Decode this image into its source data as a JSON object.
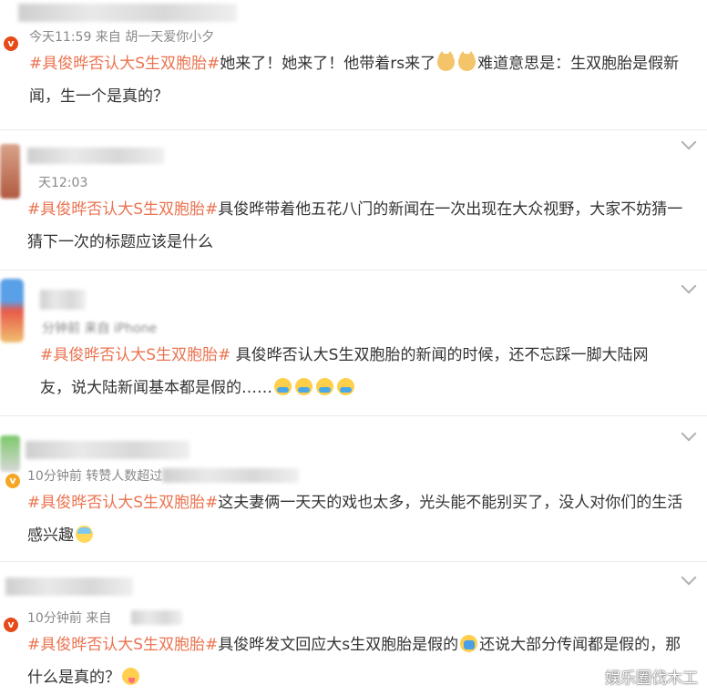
{
  "posts": [
    {
      "meta": "今天11:59  来自 胡一天爱你小夕",
      "tag": "#具俊晔否认大S生双胞胎#",
      "text": "她来了！她来了！他带着rs来了",
      "emojis": [
        "cat-icon",
        "cat-icon"
      ],
      "text2": "难道意思是：生双胞胎是假新闻，生一个是真的？"
    },
    {
      "meta": "天12:03",
      "tag": "#具俊晔否认大S生双胞胎#",
      "text": "具俊晔带着他五花八门的新闻在一次出现在大众视野，大家不妨猜一猜下一次的标题应该是什么",
      "emojis": [],
      "text2": ""
    },
    {
      "meta": "分钟前  来自 iPhone",
      "tag": "#具俊晔否认大S生双胞胎#",
      "text": " 具俊晔否认大S生双胞胎的新闻的时候，还不忘踩一脚大陆网友，说大陆新闻基本都是假的……",
      "emojis": [
        "crying-icon",
        "crying-icon",
        "crying-icon",
        "crying-icon"
      ],
      "text2": ""
    },
    {
      "meta": "10分钟前  转赞人数超过",
      "tag": "#具俊晔否认大S生双胞胎#",
      "text": "这夫妻俩一天天的戏也太多，光头能不能别买了，没人对你们的生活感兴趣",
      "emojis": [
        "fearful-icon"
      ],
      "text2": ""
    },
    {
      "meta": "10分钟前  来自",
      "tag": "#具俊晔否认大S生双胞胎#",
      "text": "具俊晔发文回应大s生双胞胎是假的",
      "emojis": [
        "facepalm-icon"
      ],
      "text2": "还说大部分传闻都是假的，那什么是真的？",
      "emojis2": [
        "yum-icon"
      ]
    }
  ],
  "watermark": "娱乐圈伐木工",
  "colors": {
    "tag": "#eb7350",
    "text": "#333333",
    "meta": "#888888"
  }
}
